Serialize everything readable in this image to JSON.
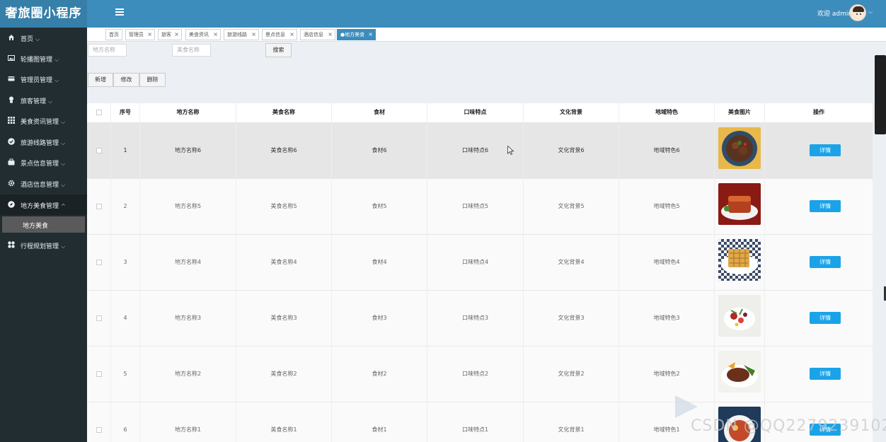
{
  "app": {
    "brand": "奢旅圈小程序",
    "welcome": "欢迎 admin"
  },
  "colors": {
    "topbar": "#3c8dbc",
    "sidebar": "#222d32",
    "detail_button": "#1aa3e8",
    "active_tab": "#3c8dbc"
  },
  "sidebar": {
    "items": [
      {
        "label": "首页",
        "icon": "home-icon"
      },
      {
        "label": "轮播图管理",
        "icon": "image-icon"
      },
      {
        "label": "管理员管理",
        "icon": "card-icon"
      },
      {
        "label": "旅客管理",
        "icon": "user-icon"
      },
      {
        "label": "美食资讯管理",
        "icon": "grid-icon"
      },
      {
        "label": "旅游线路管理",
        "icon": "check-icon"
      },
      {
        "label": "景点信息管理",
        "icon": "bag-icon"
      },
      {
        "label": "酒店信息管理",
        "icon": "gear-icon"
      },
      {
        "label": "地方美食管理",
        "icon": "compass-icon"
      },
      {
        "label": "行程规划管理",
        "icon": "apps-icon"
      }
    ],
    "sub_item": "地方美食"
  },
  "tabs": [
    {
      "label": "首页",
      "closable": false
    },
    {
      "label": "管理员",
      "closable": true
    },
    {
      "label": "旅客",
      "closable": true
    },
    {
      "label": "美食资讯",
      "closable": true
    },
    {
      "label": "旅游线路",
      "closable": true
    },
    {
      "label": "景点信息",
      "closable": true
    },
    {
      "label": "酒店信息",
      "closable": true
    },
    {
      "label": "●地方美食",
      "closable": true,
      "active": true
    }
  ],
  "search": {
    "place_placeholder": "地方名称",
    "food_placeholder": "美食名称",
    "search_label": "搜索"
  },
  "toolbar": {
    "add": "新增",
    "edit": "修改",
    "delete": "删除"
  },
  "table": {
    "columns": [
      "序号",
      "地方名称",
      "美食名称",
      "食材",
      "口味特点",
      "文化背景",
      "地域特色",
      "美食图片",
      "操作"
    ],
    "detail_label": "详情",
    "rows": [
      {
        "no": "1",
        "place": "地方名称6",
        "food": "美食名称6",
        "ingredient": "食材6",
        "taste": "口味特点6",
        "culture": "文化背景6",
        "region": "地域特色6"
      },
      {
        "no": "2",
        "place": "地方名称5",
        "food": "美食名称5",
        "ingredient": "食材5",
        "taste": "口味特点5",
        "culture": "文化背景5",
        "region": "地域特色5"
      },
      {
        "no": "3",
        "place": "地方名称4",
        "food": "美食名称4",
        "ingredient": "食材4",
        "taste": "口味特点4",
        "culture": "文化背景4",
        "region": "地域特色4"
      },
      {
        "no": "4",
        "place": "地方名称3",
        "food": "美食名称3",
        "ingredient": "食材3",
        "taste": "口味特点3",
        "culture": "文化背景3",
        "region": "地域特色3"
      },
      {
        "no": "5",
        "place": "地方名称2",
        "food": "美食名称2",
        "ingredient": "食材2",
        "taste": "口味特点2",
        "culture": "文化背景2",
        "region": "地域特色2"
      },
      {
        "no": "6",
        "place": "地方名称1",
        "food": "美食名称1",
        "ingredient": "食材1",
        "taste": "口味特点1",
        "culture": "文化背景1",
        "region": "地域特色1"
      }
    ]
  },
  "watermark": "CSDN @QQ2279239102"
}
